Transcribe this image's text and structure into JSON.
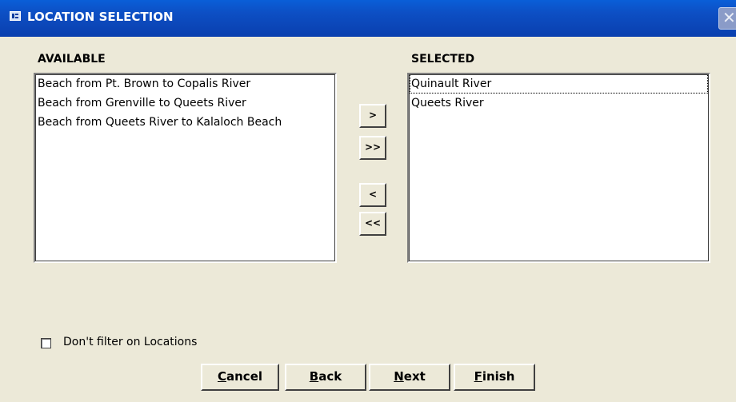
{
  "window": {
    "title": "LOCATION SELECTION",
    "close_glyph": "✕"
  },
  "available": {
    "label": "AVAILABLE",
    "items": [
      "Beach from Pt. Brown to Copalis River",
      "Beach from Grenville to Queets River",
      "Beach from Queets River to Kalaloch Beach"
    ]
  },
  "selected": {
    "label": "SELECTED",
    "items": [
      "Quinault River",
      "Queets River"
    ]
  },
  "transfer": {
    "add_one": ">",
    "add_all": ">>",
    "remove_one": "<",
    "remove_all": "<<"
  },
  "filter": {
    "label": "Don't filter on Locations",
    "checked": false
  },
  "buttons": {
    "cancel_key": "C",
    "cancel_rest": "ancel",
    "back_key": "B",
    "back_rest": "ack",
    "next_key": "N",
    "next_rest": "ext",
    "finish_key": "F",
    "finish_rest": "inish"
  }
}
